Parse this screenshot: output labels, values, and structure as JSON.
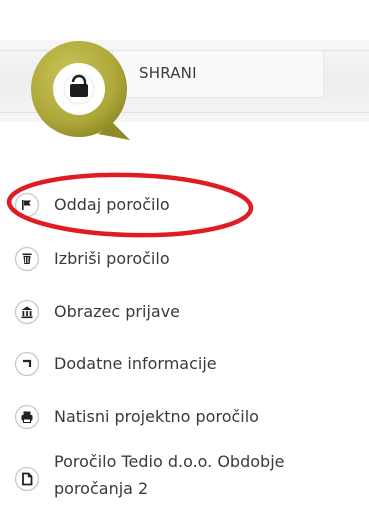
{
  "save": {
    "label": "SHRANI",
    "icon": "lock-icon",
    "colors": {
      "ring": "#b3ad3c",
      "ring_dark": "#8f8a28",
      "center": "#1d1d1d"
    }
  },
  "menu": {
    "items": [
      {
        "name": "submit-report",
        "label": "Oddaj poročilo",
        "icon": "flag-icon"
      },
      {
        "name": "delete-report",
        "label": "Izbriši poročilo",
        "icon": "trash-icon"
      },
      {
        "name": "application-form",
        "label": "Obrazec prijave",
        "icon": "building-icon"
      },
      {
        "name": "additional-info",
        "label": "Dodatne informacije",
        "icon": "info-corner-icon"
      },
      {
        "name": "print-report",
        "label": "Natisni projektno poročilo",
        "icon": "printer-icon"
      },
      {
        "name": "tedio-report",
        "label": "Poročilo Tedio d.o.o. Obdobje poročanja 2",
        "icon": "document-icon"
      }
    ]
  },
  "highlight": {
    "color": "#e01b24"
  }
}
